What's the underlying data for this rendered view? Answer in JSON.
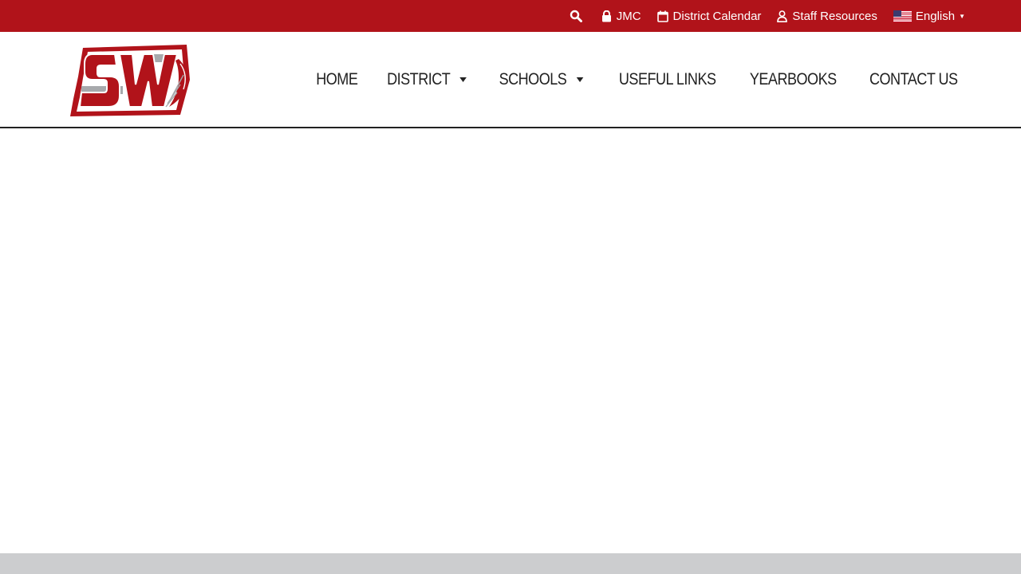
{
  "topbar": {
    "background": "#b1131a",
    "search_icon": "search-icon",
    "jmc_label": "JMC",
    "calendar_label": "District Calendar",
    "staff_label": "Staff Resources",
    "language_label": "English"
  },
  "logo": {
    "text": "SW",
    "primary_color": "#b1131a",
    "secondary_color": "#a7a9ac"
  },
  "nav": {
    "items": [
      {
        "label": "HOME"
      },
      {
        "label": "DISTRICT"
      },
      {
        "label": "SCHOOLS"
      },
      {
        "label": "USEFUL LINKS"
      },
      {
        "label": "YEARBOOKS"
      },
      {
        "label": "CONTACT US"
      }
    ]
  }
}
